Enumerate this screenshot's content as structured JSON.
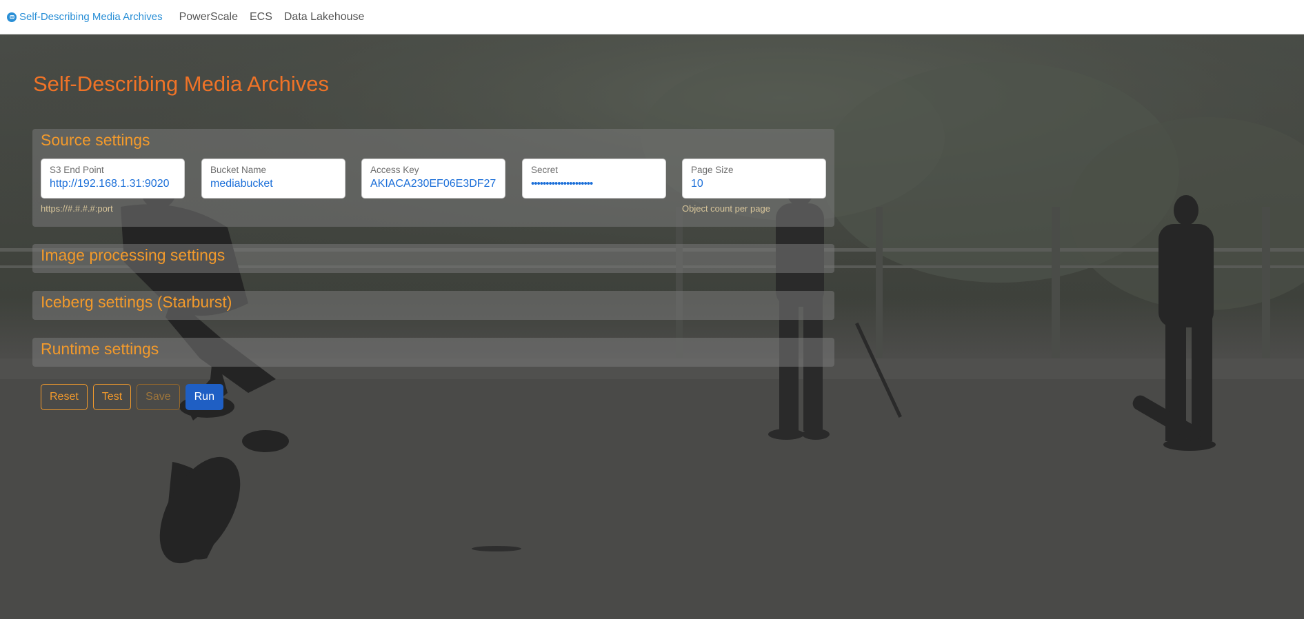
{
  "navbar": {
    "brand": "Self-Describing Media Archives",
    "links": [
      "PowerScale",
      "ECS",
      "Data Lakehouse"
    ]
  },
  "page_title": "Self-Describing Media Archives",
  "panels": {
    "source": {
      "title": "Source settings",
      "fields": {
        "endpoint": {
          "label": "S3 End Point",
          "value": "http://192.168.1.31:9020",
          "help": "https://#.#.#.#:port"
        },
        "bucket": {
          "label": "Bucket Name",
          "value": "mediabucket"
        },
        "access_key": {
          "label": "Access Key",
          "value": "AKIACA230EF06E3DF27"
        },
        "secret": {
          "label": "Secret",
          "value": "•••••••••••••••••••••"
        },
        "page_size": {
          "label": "Page Size",
          "value": "10",
          "help": "Object count per page"
        }
      }
    },
    "image": {
      "title": "Image processing settings"
    },
    "iceberg": {
      "title": "Iceberg settings (Starburst)"
    },
    "runtime": {
      "title": "Runtime settings"
    }
  },
  "buttons": {
    "reset": "Reset",
    "test": "Test",
    "save": "Save",
    "run": "Run"
  },
  "colors": {
    "accent_orange": "#f07327",
    "panel_title": "#f39a2b",
    "brand_blue": "#2a8fd6",
    "primary_button": "#1f5fc4",
    "input_text": "#1a6ed8"
  },
  "icons": [
    "brand-logo-icon"
  ]
}
